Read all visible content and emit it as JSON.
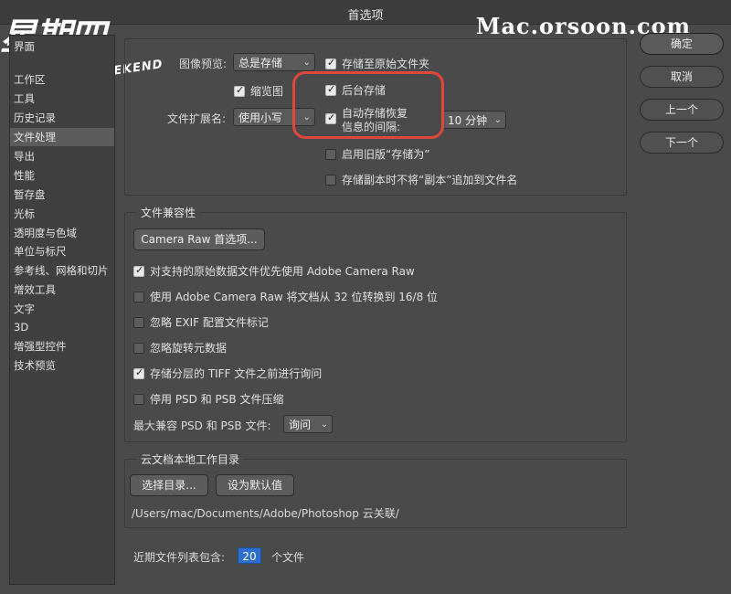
{
  "window": {
    "title": "首选项"
  },
  "watermark": {
    "brand": "Mac.orsoon.com",
    "logo": "星期四",
    "logo_sub": "NEAR WEEKEND"
  },
  "sidebar": {
    "items": [
      {
        "label": "界面"
      },
      {
        "label": "工作区"
      },
      {
        "label": "工具"
      },
      {
        "label": "历史记录"
      },
      {
        "label": "文件处理",
        "active": true
      },
      {
        "label": "导出"
      },
      {
        "label": "性能"
      },
      {
        "label": "暂存盘"
      },
      {
        "label": "光标"
      },
      {
        "label": "透明度与色域"
      },
      {
        "label": "单位与标尺"
      },
      {
        "label": "参考线、网格和切片"
      },
      {
        "label": "增效工具"
      },
      {
        "label": "文字"
      },
      {
        "label": "3D"
      },
      {
        "label": "增强型控件"
      },
      {
        "label": "技术预览"
      }
    ]
  },
  "actions": {
    "ok": "确定",
    "cancel": "取消",
    "prev": "上一个",
    "next": "下一个"
  },
  "file_saving": {
    "preview_label": "图像预览:",
    "preview_value": "总是存储",
    "thumbnail": {
      "label": "缩览图",
      "checked": true
    },
    "ext_label": "文件扩展名:",
    "ext_value": "使用小写",
    "save_to_original": {
      "label": "存储至原始文件夹",
      "checked": true
    },
    "background_save": {
      "label": "后台存储",
      "checked": true
    },
    "autosave": {
      "label": "自动存储恢复信息的间隔:",
      "label_line1": "自动存储恢复",
      "label_line2": "信息的间隔:",
      "checked": true,
      "interval": "10 分钟"
    },
    "legacy_save_as": {
      "label": "启用旧版“存储为”",
      "checked": false
    },
    "no_copy_suffix": {
      "label": "存储副本时不将“副本”追加到文件名",
      "checked": false
    }
  },
  "compat": {
    "title": "文件兼容性",
    "camera_raw_button": "Camera Raw 首选项...",
    "options": [
      {
        "label": "对支持的原始数据文件优先使用 Adobe Camera Raw",
        "checked": true
      },
      {
        "label": "使用 Adobe Camera Raw 将文档从 32 位转换到 16/8 位",
        "checked": false
      },
      {
        "label": "忽略 EXIF 配置文件标记",
        "checked": false
      },
      {
        "label": "忽略旋转元数据",
        "checked": false
      },
      {
        "label": "存储分层的 TIFF 文件之前进行询问",
        "checked": true
      },
      {
        "label": "停用 PSD 和 PSB 文件压缩",
        "checked": false
      }
    ],
    "max_compat_label": "最大兼容 PSD 和 PSB 文件:",
    "max_compat_value": "询问"
  },
  "cloud": {
    "title": "云文档本地工作目录",
    "choose_button": "选择目录...",
    "default_button": "设为默认值",
    "path": "/Users/mac/Documents/Adobe/Photoshop 云关联/"
  },
  "recent": {
    "label": "近期文件列表包含:",
    "value": "20",
    "suffix": "个文件"
  },
  "colors": {
    "highlight": "#e0493a",
    "selection": "#2d6fd1",
    "background": "#4a4a4a"
  }
}
